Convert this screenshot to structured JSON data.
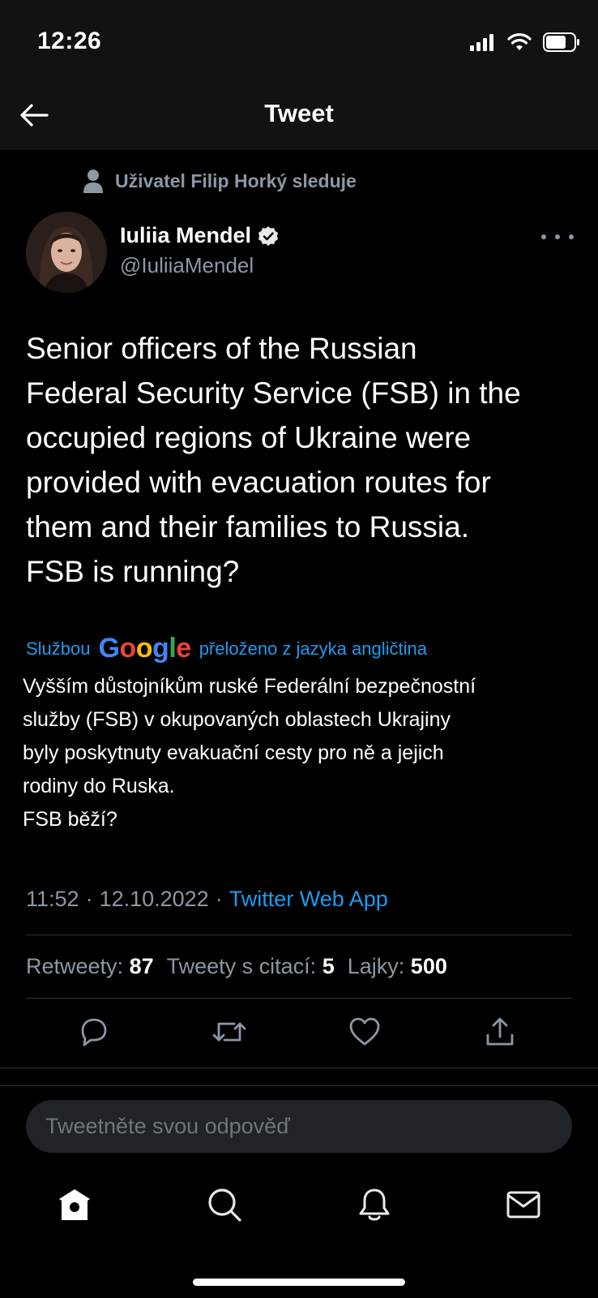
{
  "status_bar": {
    "time": "12:26"
  },
  "header": {
    "title": "Tweet"
  },
  "social_context": {
    "text": "Uživatel Filip Horký sleduje"
  },
  "author": {
    "name": "Iuliia Mendel",
    "handle": "@IuliiaMendel"
  },
  "tweet": {
    "text": "Senior officers of the Russian\nFederal Security Service (FSB) in the\noccupied regions of Ukraine were\nprovided with evacuation routes for\nthem and their families to Russia.\nFSB is running?",
    "translation_prefix": "Službou",
    "translation_brand": "Google",
    "translation_suffix": "přeloženo z jazyka angličtina",
    "translated_text": "Vyšším důstojníkům ruské Federální bezpečnostní\nslužby (FSB) v okupovaných oblastech Ukrajiny\nbyly poskytnuty evakuační cesty pro ně a jejich\nrodiny do Ruska.\nFSB běží?",
    "time": "11:52",
    "separator": "·",
    "date": "12.10.2022",
    "source": "Twitter Web App"
  },
  "stats": {
    "retweets_label": "Retweety:",
    "retweets": "87",
    "quotes_label": "Tweety s citací:",
    "quotes": "5",
    "likes_label": "Lajky:",
    "likes": "500"
  },
  "reply": {
    "placeholder": "Tweetněte svou odpověď"
  },
  "icons": {
    "back": "arrow-left-icon",
    "reply": "comment-icon",
    "retweet": "retweet-icon",
    "like": "heart-icon",
    "share": "share-icon",
    "home": "home-icon",
    "search": "search-icon",
    "notifications": "bell-icon",
    "messages": "mail-icon"
  },
  "colors": {
    "accent": "#1d9bf0",
    "muted": "#8b98a5",
    "background": "#000000",
    "header_bg": "#121212"
  }
}
